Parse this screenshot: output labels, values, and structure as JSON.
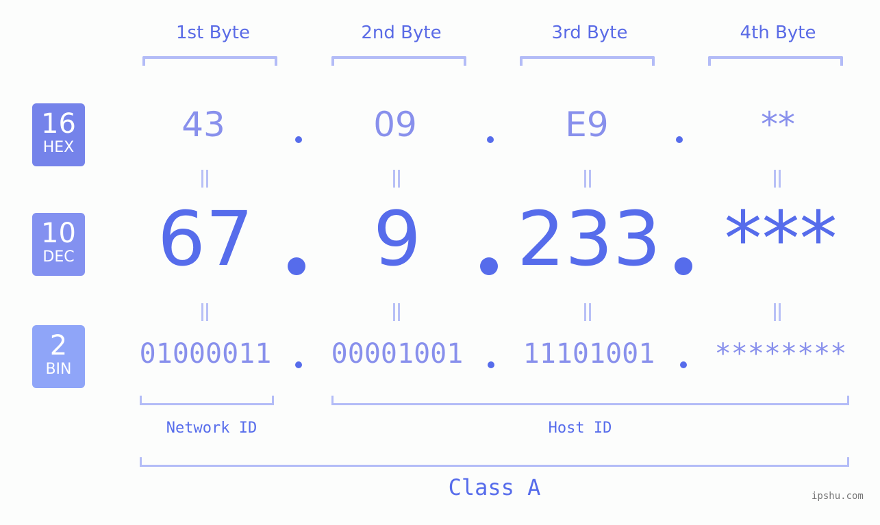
{
  "headers": [
    "1st Byte",
    "2nd Byte",
    "3rd Byte",
    "4th Byte"
  ],
  "badges": {
    "hex": {
      "number": "16",
      "label": "HEX",
      "color": "#7583ea"
    },
    "dec": {
      "number": "10",
      "label": "DEC",
      "color": "#8391f0"
    },
    "bin": {
      "number": "2",
      "label": "BIN",
      "color": "#8fa5f8"
    }
  },
  "hex": [
    "43",
    "09",
    "E9",
    "**"
  ],
  "dec": [
    "67",
    "9",
    "233",
    "***"
  ],
  "bin": [
    "01000011",
    "00001001",
    "11101001",
    "********"
  ],
  "network_label": "Network ID",
  "host_label": "Host ID",
  "class_label": "Class A",
  "watermark": "ipshu.com",
  "colors": {
    "primary": "#566ceb",
    "light": "#8890ec",
    "bracket": "#b3bcf7"
  }
}
